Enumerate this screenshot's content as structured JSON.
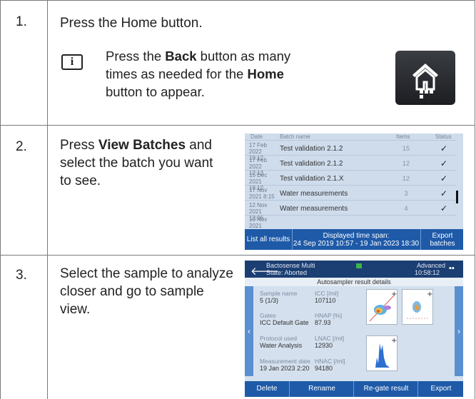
{
  "steps": [
    {
      "num": "1.",
      "text": "Press the Home button."
    },
    {
      "num": "2.",
      "text_bold": "View Batches",
      "text_pre": "Press ",
      "text_post": " and select the batch you want to see."
    },
    {
      "num": "3.",
      "text": "Select the sample to analyze closer and go to sample view."
    }
  ],
  "note": {
    "pre": "Press the ",
    "b1": "Back",
    "mid": " button as many times as needed for the ",
    "b2": "Home",
    "post": " button to appear."
  },
  "icons": {
    "info": "i"
  },
  "batches": {
    "headers": {
      "date": "Date",
      "name": "Batch name",
      "items": "Items",
      "status": "Status"
    },
    "rows": [
      {
        "date": "17 Feb 2022 19:12",
        "name": "Test validation 2.1.2",
        "items": "15",
        "status": "✓"
      },
      {
        "date": "17 Feb 2022 12:13",
        "name": "Test validation 2.1.2",
        "items": "12",
        "status": "✓"
      },
      {
        "date": "15 Dec 2021 18:12",
        "name": "Test validation 2.1.X",
        "items": "12",
        "status": "✓"
      },
      {
        "date": "17 Nov 2021 8:15",
        "name": "Water measurements",
        "items": "3",
        "status": "✓"
      },
      {
        "date": "12 Nov 2021 13:06",
        "name": "Water measurements",
        "items": "4",
        "status": "✓"
      }
    ],
    "partial_row": "10 Nov 2021",
    "list_all": "List all results",
    "span_label": "Displayed time span:",
    "span_value": "24 Sep 2019 10:57 - 19 Jan 2023 18:30",
    "export": "Export batches"
  },
  "auto": {
    "device": "Bactosense Multi",
    "state": "State: Aborted",
    "mode": "Advanced",
    "time": "10:58:12",
    "title": "Autosampler result details",
    "fields": [
      {
        "label": "Sample name",
        "value": "5 (1/3)"
      },
      {
        "label": "Gates",
        "value": "ICC Default Gate"
      },
      {
        "label": "Protocol used",
        "value": "Water Analysis"
      },
      {
        "label": "Measurement date",
        "value": "19 Jan 2023 2:20"
      }
    ],
    "metrics": [
      {
        "label": "ICC [/ml]",
        "value": "107110"
      },
      {
        "label": "HNAP [%]",
        "value": "87.93"
      },
      {
        "label": "LNAC [/ml]",
        "value": "12930"
      },
      {
        "label": "HNAC [/ml]",
        "value": "94180"
      }
    ],
    "buttons": [
      "Delete",
      "Rename",
      "Re-gate result",
      "Export"
    ]
  },
  "colors": {
    "accent": "#1e5aa8",
    "header": "#1c3f73",
    "panel": "#cfdcec"
  }
}
